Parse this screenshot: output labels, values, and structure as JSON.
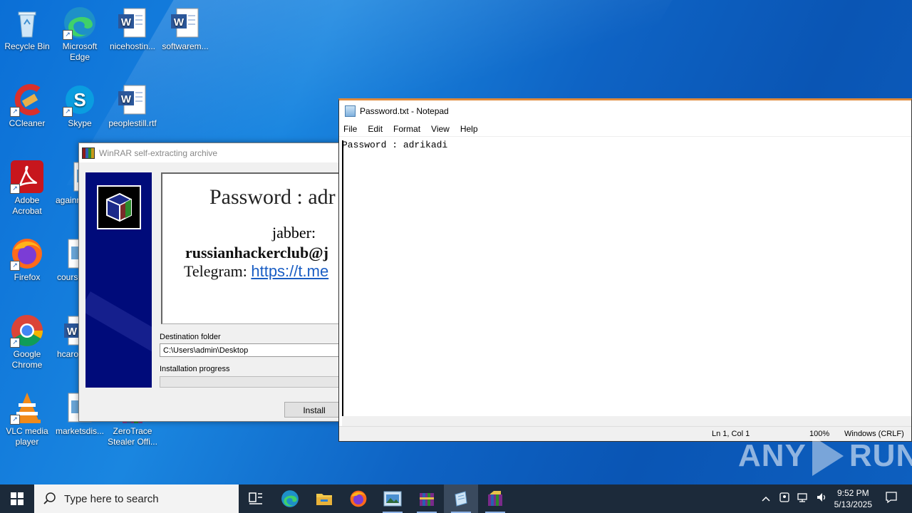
{
  "desktop_icons": [
    {
      "label": "Recycle Bin",
      "icon": "recycle-bin-icon"
    },
    {
      "label": "Microsoft Edge",
      "icon": "edge-icon"
    },
    {
      "label": "nicehostin...",
      "icon": "word-doc-icon"
    },
    {
      "label": "softwarem...",
      "icon": "word-doc-icon"
    },
    {
      "label": "CCleaner",
      "icon": "ccleaner-icon"
    },
    {
      "label": "Skype",
      "icon": "skype-icon"
    },
    {
      "label": "peoplestill.rtf",
      "icon": "word-doc-icon"
    },
    {
      "label": "Adobe Acrobat",
      "icon": "acrobat-icon"
    },
    {
      "label": "againr",
      "icon": "image-file-icon"
    },
    {
      "label": "Firefox",
      "icon": "firefox-icon"
    },
    {
      "label": "course",
      "icon": "image-file-icon"
    },
    {
      "label": "Google Chrome",
      "icon": "chrome-icon"
    },
    {
      "label": "hcaro",
      "icon": "word-doc-icon"
    },
    {
      "label": "VLC media player",
      "icon": "vlc-icon"
    },
    {
      "label": "marketsdis...",
      "icon": "image-file-icon"
    },
    {
      "label": "ZeroTrace Stealer Offi...",
      "icon": "winrar-archive-icon"
    }
  ],
  "winrar": {
    "title": "WinRAR self-extracting archive",
    "password_line": "Password : adr",
    "jabber_label": "jabber:",
    "jabber_value": "russianhackerclub@j",
    "telegram_label": "Telegram: ",
    "telegram_link": "https://t.me",
    "destination_label": "Destination folder",
    "destination_value": "C:\\Users\\admin\\Desktop",
    "progress_label": "Installation progress",
    "progress": 0,
    "install_button": "Install"
  },
  "notepad": {
    "title": "Password.txt - Notepad",
    "menu": [
      "File",
      "Edit",
      "Format",
      "View",
      "Help"
    ],
    "content": "Password : adrikadi",
    "status": {
      "position": "Ln 1, Col 1",
      "zoom": "100%",
      "line_endings": "Windows (CRLF)"
    }
  },
  "watermark": {
    "left": "ANY",
    "right": "RUN"
  },
  "taskbar": {
    "search_placeholder": "Type here to search",
    "pinned": [
      "task-view-icon",
      "edge-icon",
      "file-explorer-icon",
      "firefox-icon",
      "image-viewer-icon",
      "winrar-icon",
      "notepad-icon",
      "winrar-sfx-icon"
    ],
    "time": "9:52 PM",
    "date": "5/13/2025"
  },
  "colors": {
    "taskbar": "#1c2a3a",
    "desktop": "#0b6fd6",
    "link": "#1a5ec4",
    "notepad_border": "#e08a3a"
  }
}
